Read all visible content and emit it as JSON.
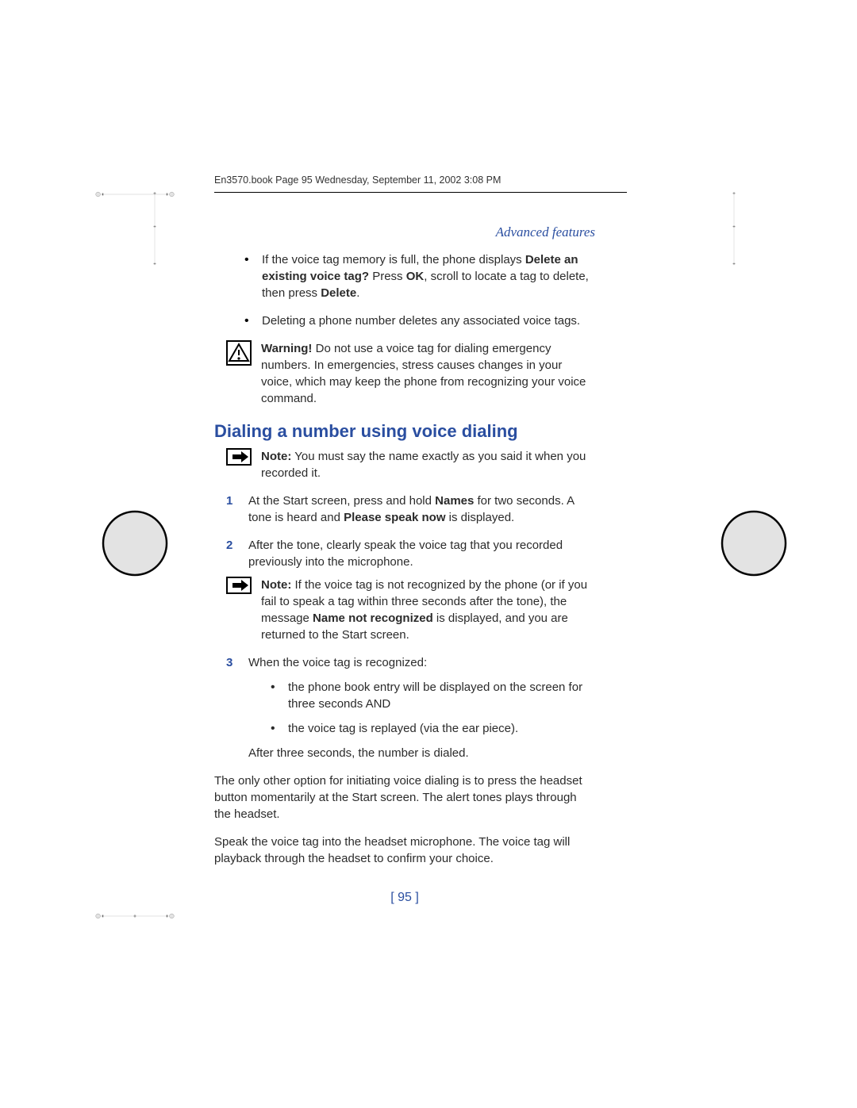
{
  "meta": {
    "stamp": "En3570.book  Page 95  Wednesday, September 11, 2002  3:08 PM"
  },
  "section": "Advanced features",
  "bullets": {
    "b1_part1": "If the voice tag memory is full, the phone displays ",
    "b1_bold1": "Delete an existing voice tag?",
    "b1_part2": " Press ",
    "b1_bold2": "OK",
    "b1_part3": ", scroll to locate a tag to delete, then press ",
    "b1_bold3": "Delete",
    "b1_part4": ".",
    "b2": "Deleting a phone number deletes any associated voice tags."
  },
  "warning": {
    "label": "Warning!",
    "text": " Do not use a voice tag for dialing emergency numbers. In emergencies, stress causes changes in your voice, which may keep the phone from recognizing your voice command."
  },
  "h2": "Dialing a number using voice dialing",
  "note1": {
    "label": "Note:",
    "text": " You must say the name exactly as you said it when you recorded it."
  },
  "steps": {
    "s1": {
      "num": "1",
      "part1": "At the Start screen, press and hold ",
      "bold1": "Names",
      "part2": " for two seconds. A tone is heard and ",
      "bold2": "Please speak now",
      "part3": " is displayed."
    },
    "s2": {
      "num": "2",
      "text": "After the tone, clearly speak the voice tag that you recorded previously into the microphone."
    },
    "note2": {
      "label": "Note:",
      "part1": " If the voice tag is not recognized by the phone (or if you fail to speak a tag within three seconds after the tone), the message ",
      "bold1": "Name not recognized",
      "part2": " is displayed, and you are returned to the Start screen."
    },
    "s3": {
      "num": "3",
      "intro": "When the voice tag is recognized:",
      "sub1": "the phone book entry will be displayed on the screen for three seconds AND",
      "sub2": "the voice tag is replayed (via the ear piece).",
      "after": "After three seconds, the number is dialed."
    }
  },
  "closing": {
    "p1": "The only other option for initiating voice dialing is to press the headset button momentarily at the Start screen. The alert tones plays through the headset.",
    "p2": "Speak the voice tag into the headset microphone. The voice tag will playback through the headset to confirm your choice."
  },
  "pagenum": "[ 95 ]"
}
